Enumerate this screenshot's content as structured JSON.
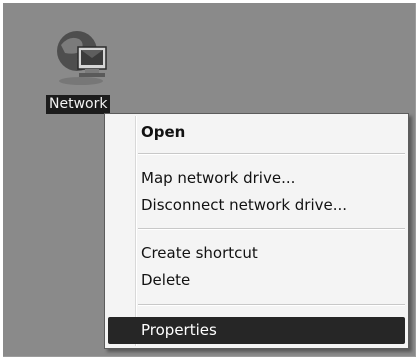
{
  "desktop": {
    "icon": {
      "name": "network-icon",
      "label": "Network"
    }
  },
  "context_menu": {
    "items": [
      {
        "label": "Open",
        "bold": true
      },
      {
        "label": "Map network drive..."
      },
      {
        "label": "Disconnect network drive..."
      },
      {
        "label": "Create shortcut"
      },
      {
        "label": "Delete"
      },
      {
        "label": "Properties",
        "selected": true
      }
    ]
  },
  "colors": {
    "desktop_bg": "#8a8a8a",
    "menu_bg": "#f4f4f4",
    "highlight": "#262626",
    "label_bg": "#1c1c1c"
  }
}
